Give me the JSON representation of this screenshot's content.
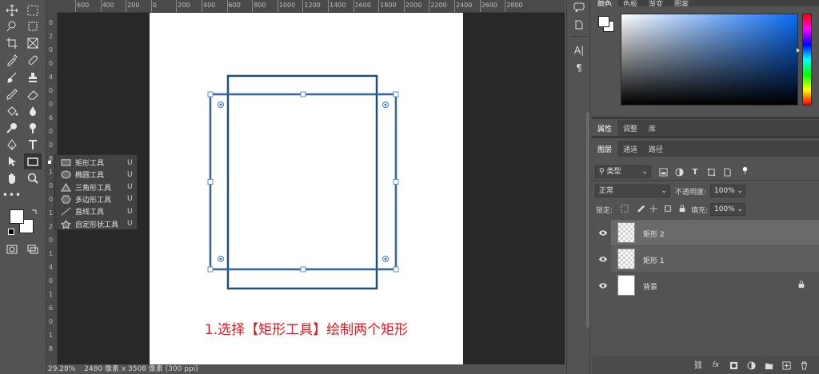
{
  "flyout": {
    "items": [
      {
        "label": "矩形工具",
        "key": "U",
        "icon": "rectangle-icon"
      },
      {
        "label": "椭圆工具",
        "key": "U",
        "icon": "ellipse-icon"
      },
      {
        "label": "三角形工具",
        "key": "U",
        "icon": "triangle-icon"
      },
      {
        "label": "多边形工具",
        "key": "U",
        "icon": "polygon-icon"
      },
      {
        "label": "直线工具",
        "key": "U",
        "icon": "line-icon"
      },
      {
        "label": "自定形状工具",
        "key": "U",
        "icon": "custom-shape-icon"
      }
    ]
  },
  "ruler": {
    "top_labels": [
      "600",
      "400",
      "200",
      "0",
      "200",
      "400",
      "600",
      "800",
      "1000",
      "1200",
      "1400",
      "1600",
      "1800",
      "2000",
      "2200",
      "2400",
      "2600",
      "2800"
    ],
    "left_labels": [
      "0",
      "2",
      "0",
      "0",
      "4",
      "0",
      "0",
      "6",
      "0",
      "0",
      "8",
      "1",
      "0",
      "0",
      "1",
      "2",
      "0",
      "1",
      "4",
      "0",
      "1",
      "6",
      "0",
      "1",
      "8"
    ]
  },
  "canvas": {
    "caption": "1.选择【矩形工具】绘制两个矩形",
    "caption_color": "#e8141b",
    "rect_color": "#1f4e79"
  },
  "status": {
    "zoom": "29.28%",
    "doc_info": "2480 像素 x 3508 像素 (300 ppi)"
  },
  "panels": {
    "top_tabs": [
      "颜色",
      "色板",
      "渐变",
      "图案"
    ],
    "props_tabs": [
      "属性",
      "调整",
      "库"
    ],
    "layer_tabs": [
      "图层",
      "通道",
      "路径"
    ],
    "filter_kind": "类型",
    "blend_mode": "正常",
    "opacity_label": "不透明度:",
    "opacity_value": "100%",
    "lock_label": "锁定:",
    "fill_label": "填充:",
    "fill_value": "100%",
    "layers": [
      {
        "name": "矩形 2"
      },
      {
        "name": "矩形 1"
      },
      {
        "name": "背景"
      }
    ]
  }
}
